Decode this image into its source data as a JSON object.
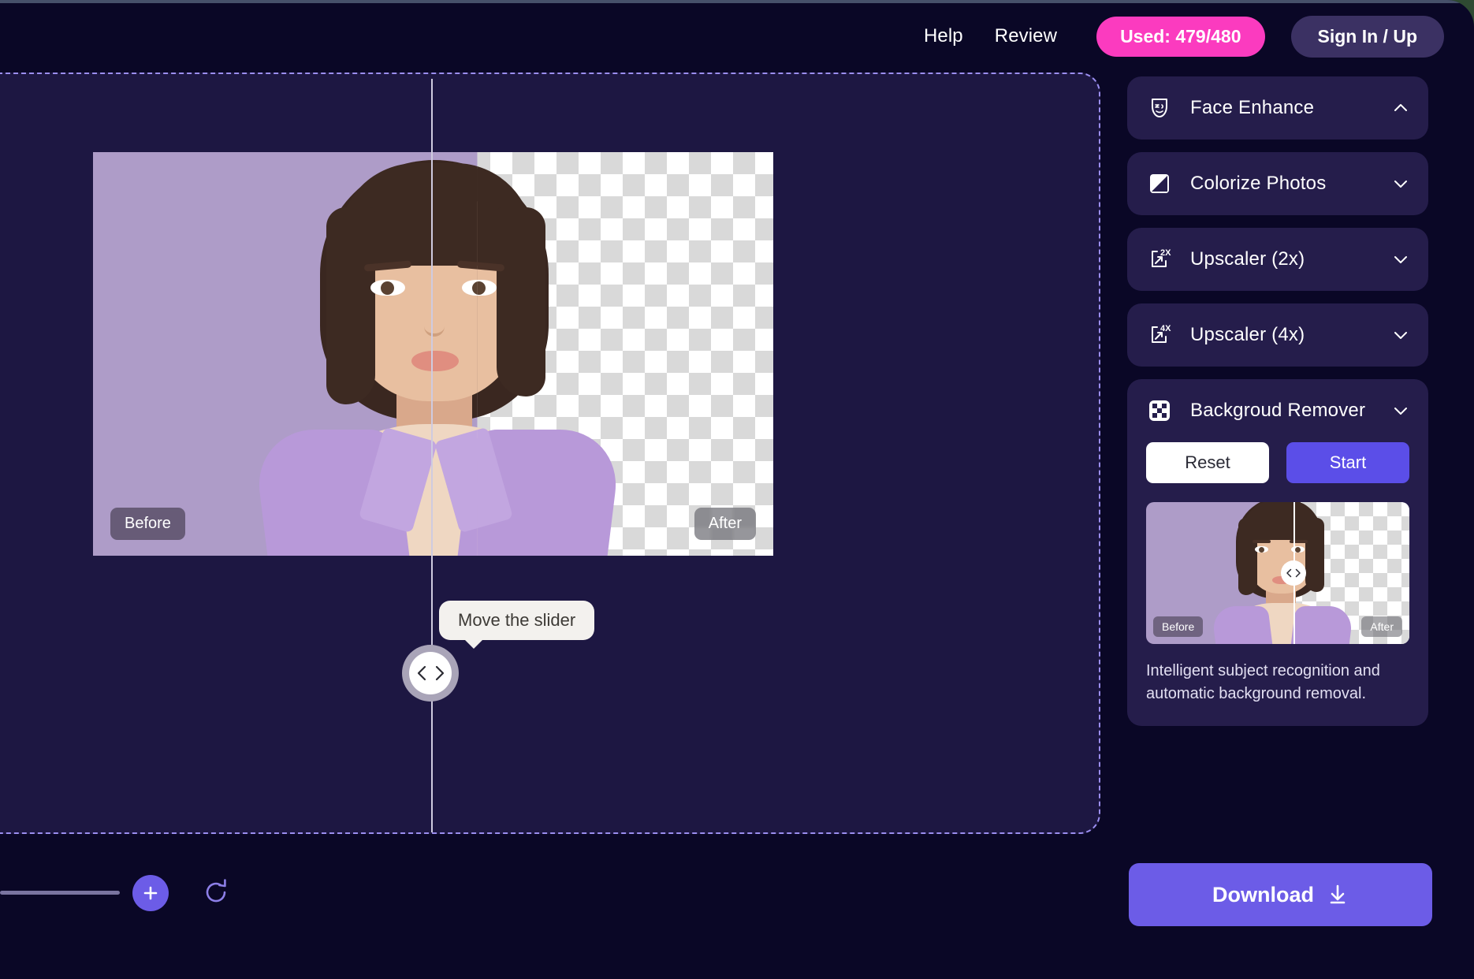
{
  "header": {
    "help_label": "Help",
    "review_label": "Review",
    "used_badge": "Used: 479/480",
    "signin_label": "Sign In / Up",
    "badge_color": "#fb3bbf",
    "signin_bg": "#3b3163"
  },
  "canvas": {
    "before_tag": "Before",
    "after_tag": "After",
    "tooltip": "Move the slider",
    "before_bg_color": "#ae9cc8",
    "dash_border_color": "#9b8ef0"
  },
  "bottom_left": {
    "add_icon": "plus-icon",
    "refresh_icon": "refresh-icon"
  },
  "sidebar": {
    "panels": [
      {
        "label": "Face Enhance",
        "icon": "face-mask-icon",
        "expanded": true,
        "chevron": "chevron-up-icon"
      },
      {
        "label": "Colorize Photos",
        "icon": "color-split-icon",
        "expanded": false,
        "chevron": "chevron-down-icon"
      },
      {
        "label": "Upscaler (2x)",
        "icon": "upscale-2x-icon",
        "expanded": false,
        "chevron": "chevron-down-icon"
      },
      {
        "label": "Upscaler (4x)",
        "icon": "upscale-4x-icon",
        "expanded": false,
        "chevron": "chevron-down-icon"
      },
      {
        "label": "Backgroud Remover",
        "icon": "checkerboard-icon",
        "expanded": true,
        "chevron": "chevron-down-icon"
      }
    ],
    "background_remover": {
      "reset_label": "Reset",
      "start_label": "Start",
      "start_color": "#5b4ee8",
      "thumb_before_tag": "Before",
      "thumb_after_tag": "After",
      "description": "Intelligent subject recognition and automatic background removal."
    }
  },
  "download": {
    "label": "Download",
    "icon": "download-arrow-icon",
    "color": "#6c5ce7"
  }
}
